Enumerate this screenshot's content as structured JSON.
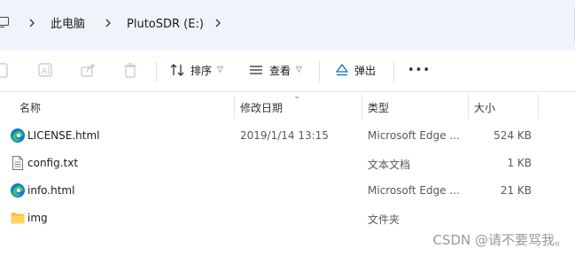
{
  "address": {
    "crumbs": [
      "此电脑",
      "PlutoSDR (E:)"
    ]
  },
  "toolbar": {
    "sort_label": "排序",
    "view_label": "查看",
    "eject_label": "弹出",
    "more_label": "•••"
  },
  "columns": {
    "name": "名称",
    "modified": "修改日期",
    "type": "类型",
    "size": "大小"
  },
  "files": [
    {
      "name": "LICENSE.html",
      "modified": "2019/1/14 13:15",
      "type": "Microsoft Edge ...",
      "size": "524 KB",
      "icon": "edge-icon"
    },
    {
      "name": "config.txt",
      "modified": "",
      "type": "文本文档",
      "size": "1 KB",
      "icon": "text-file-icon"
    },
    {
      "name": "info.html",
      "modified": "",
      "type": "Microsoft Edge ...",
      "size": "21 KB",
      "icon": "edge-icon"
    },
    {
      "name": "img",
      "modified": "",
      "type": "文件夹",
      "size": "",
      "icon": "folder-icon"
    }
  ],
  "watermark": "CSDN @请不要骂我。",
  "colors": {
    "address_bg": "#eef4f9",
    "edge_blue": "#0f7bd6",
    "edge_green": "#37c26a",
    "folder_yellow": "#f6c544"
  }
}
